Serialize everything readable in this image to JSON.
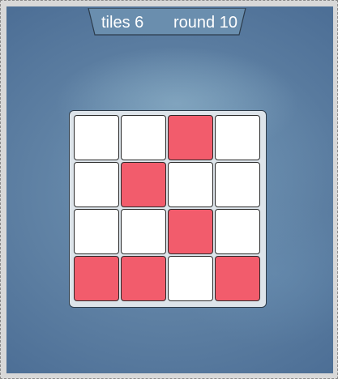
{
  "hud": {
    "tiles_label": "tiles 6",
    "round_label": "round 10"
  },
  "board": {
    "size": 4,
    "highlight_color": "#f25c6c",
    "empty_color": "#ffffff",
    "grid": [
      [
        0,
        0,
        1,
        0
      ],
      [
        0,
        1,
        0,
        0
      ],
      [
        0,
        0,
        1,
        0
      ],
      [
        1,
        1,
        0,
        1
      ]
    ]
  }
}
